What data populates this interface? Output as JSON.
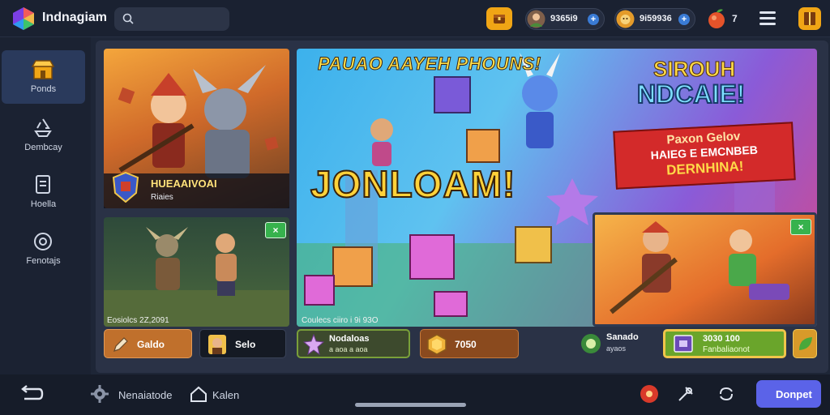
{
  "app": {
    "title": "Indnagiam"
  },
  "search": {
    "placeholder": ""
  },
  "topbar": {
    "currency1": "9365i9",
    "currency2": "9i59936",
    "fruit_count": "7",
    "icons": [
      "search-icon",
      "chest-icon",
      "plus-icon",
      "fruit-icon",
      "menu-icon",
      "book-icon"
    ]
  },
  "sidebar": {
    "items": [
      {
        "label": "Ponds",
        "icon": "store-icon",
        "active": true
      },
      {
        "label": "Dembcay",
        "icon": "recycle-icon",
        "active": false
      },
      {
        "label": "Hoella",
        "icon": "document-icon",
        "active": false
      },
      {
        "label": "Fenotajs",
        "icon": "settings-badge-icon",
        "active": false
      }
    ]
  },
  "cards": {
    "hero": {
      "title": "HUEAAIVOAI",
      "subtitle": "Riaies"
    },
    "battle": {
      "caption": "Eosiolcs 2Z,2091"
    },
    "main": {
      "banner_top": "PAUAO AAYEH PHOUNS!",
      "banner_big": "JONLOAM!",
      "caption": "Coulecs ciiro i 9i 93O"
    },
    "sign": {
      "line1": "SIROUH",
      "line2": "NDCAIE!",
      "red_line1": "Paxon Gelov",
      "red_line2": "HAIEG E EMCNBEB",
      "red_line3": "DERNHINA!"
    },
    "close_label": "×"
  },
  "actions": {
    "gold": {
      "label": "Galdo"
    },
    "sell": {
      "label": "Selo"
    },
    "bundle": {
      "label": "Nodaloas",
      "sub": "a aoa a aoa"
    },
    "coins": {
      "label": "7050"
    },
    "sound": {
      "label": "Sanado",
      "sub": "ayaos"
    },
    "green": {
      "label": "3030 100",
      "sub": "Fanbaliaonot"
    }
  },
  "bottombar": {
    "items": [
      {
        "label": "",
        "icon": "back-icon"
      },
      {
        "label": "Nenaiatode",
        "icon": "gear-icon"
      },
      {
        "label": "Kalen",
        "icon": "home-icon"
      }
    ],
    "donate_label": "Donpet"
  },
  "colors": {
    "accent": "#5b63e8",
    "gold": "#f0a515",
    "background": "#1e2637",
    "sidebar_active": "#2a3a5c"
  }
}
